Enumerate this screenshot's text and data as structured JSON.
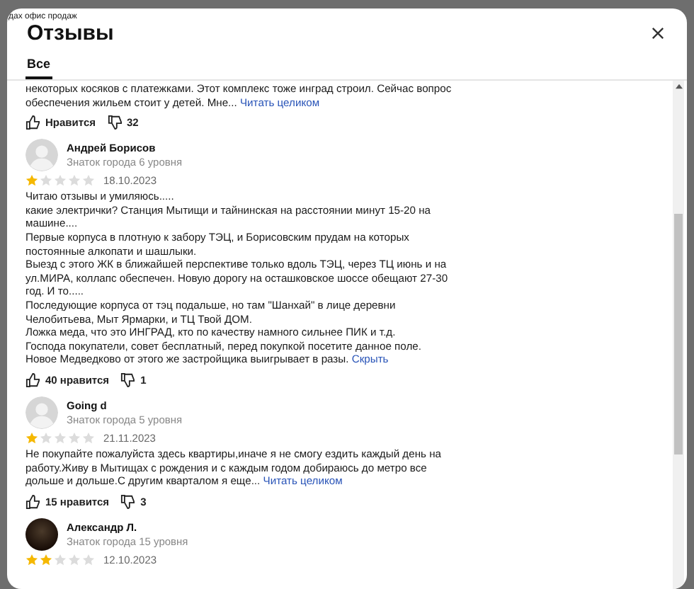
{
  "backdrop": {
    "text": "дах офис продаж"
  },
  "dialog": {
    "title": "Отзывы",
    "tabs": [
      {
        "label": "Все",
        "selected": true
      }
    ]
  },
  "reviews": [
    {
      "text": "некоторых косяков с платежками. Этот комплекс тоже инград строил. Сейчас вопрос\nобеспечения жильем стоит у детей. Мне...",
      "link": "Читать целиком",
      "likes": "Нравится",
      "dislikes": "32"
    },
    {
      "avatar": {
        "kind": "silhouette"
      },
      "author": "Андрей Борисов",
      "level": "Знаток города 6 уровня",
      "stars": 1,
      "date": "18.10.2023",
      "text": "Читаю отзывы и умиляюсь.....\nкакие электрички? Станция Мытищи и тайнинская на расстоянии минут 15-20 на\nмашине....\nПервые корпуса в плотную к забору ТЭЦ, и Борисовским прудам на которых\nпостоянные алкопати и шашлыки.\nВыезд с этого ЖК в ближайшей перспективе только вдоль ТЭЦ, через ТЦ июнь и на\nул.МИРА, коллапс обеспечен. Новую дорогу на осташковское шоссе обещают 27-30\nгод. И то.....\nПоследующие корпуса от тэц подальше, но там \"Шанхай\" в лице деревни\nЧелобитьева, Мыт Ярмарки, и ТЦ Твой ДОМ.\nЛожка меда, что это ИНГРАД, кто по качеству намного сильнее ПИК и т.д.\nГоспода покупатели, совет бесплатный, перед покупкой посетите данное поле.\nНовое Медведково от этого же застройщика выигрывает в разы.",
      "link": "Скрыть",
      "likes": "40 нравится",
      "dislikes": "1"
    },
    {
      "avatar": {
        "kind": "silhouette"
      },
      "author": "Going d",
      "level": "Знаток города 5 уровня",
      "stars": 1,
      "date": "21.11.2023",
      "text": "Не покупайте пожалуйста здесь квартиры,иначе я не смогу ездить каждый день на\nработу.Живу в Мытищах с рождения и с каждым годом добираюсь до метро все\nдольше и дольше.С другим кварталом я еще...",
      "link": "Читать целиком",
      "likes": "15 нравится",
      "dislikes": "3"
    },
    {
      "avatar": {
        "kind": "photo"
      },
      "author": "Александр Л.",
      "level": "Знаток города 15 уровня",
      "stars": 2,
      "date": "12.10.2023"
    }
  ]
}
